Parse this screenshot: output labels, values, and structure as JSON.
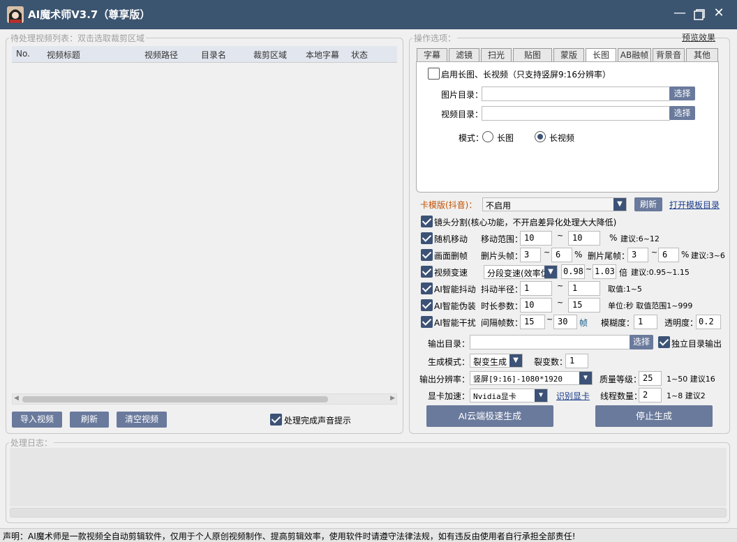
{
  "window": {
    "title": "AI魔术师V3.7（尊享版）",
    "min_icon": "minimize-icon",
    "max_icon": "maximize-icon",
    "close_icon": "close-icon"
  },
  "video_list": {
    "legend": "待处理视频列表：双击选取裁剪区域",
    "columns": [
      "No.",
      "视频标题",
      "视频路径",
      "目录名",
      "裁剪区域",
      "本地字幕",
      "状态"
    ],
    "import_btn": "导入视频",
    "refresh_btn": "刷新",
    "clear_btn": "清空视频",
    "sound_tip": "处理完成声音提示"
  },
  "options": {
    "legend": "操作选项：",
    "preview_link": "预览效果",
    "tabs": [
      "字幕",
      "滤镜",
      "扫光",
      "贴图",
      "蒙版",
      "长图",
      "AB融帧",
      "背景音",
      "其他"
    ],
    "active_tab": "长图",
    "longimg": {
      "enable": "启用长图、长视频（只支持竖屏9:16分辨率）",
      "img_dir": "图片目录：",
      "video_dir": "视频目录：",
      "choose": "选择",
      "mode": "模式：",
      "mode_a": "长图",
      "mode_b": "长视频",
      "mode_selected": "长视频"
    }
  },
  "template": {
    "label": "卡模版(抖音)：",
    "value": "不启用",
    "refresh": "刷新",
    "open_dir": "打开模板目录"
  },
  "features": {
    "lens_split": "镜头分割(核心功能，不开启差异化处理大大降低)",
    "random_move": {
      "label": "随机移动",
      "range_label": "移动范围：",
      "from": "10",
      "to": "10",
      "unit": "%",
      "hint": "建议:6~12"
    },
    "frame_cut": {
      "label": "画面删帧",
      "head_label": "删片头帧：",
      "head_from": "3",
      "head_to": "6",
      "tail_label": "删片尾帧：",
      "tail_from": "3",
      "tail_to": "6",
      "unit": "%",
      "hint": "建议:3~6"
    },
    "speed": {
      "label": "视频变速",
      "mode": "分段变速(效率优",
      "from": "0.98",
      "to": "1.03",
      "unit": "倍",
      "hint": "建议:0.95~1.15"
    },
    "shake": {
      "label": "AI智能抖动",
      "radius_label": "抖动半径：",
      "from": "1",
      "to": "1",
      "hint": "取值:1~5"
    },
    "disguise": {
      "label": "AI智能伪装",
      "duration_label": "时长参数：",
      "from": "10",
      "to": "15",
      "hint": "单位:秒 取值范围1~999"
    },
    "interfere": {
      "label": "AI智能干扰",
      "interval_label": "间隔帧数：",
      "from": "15",
      "to": "30",
      "unit": "帧",
      "blur_label": "模糊度：",
      "blur": "1",
      "alpha_label": "透明度：",
      "alpha": "0.2"
    }
  },
  "output": {
    "dir_label": "输出目录：",
    "dir": "",
    "choose": "选择",
    "independent": "独立目录输出",
    "gen_mode_label": "生成模式：",
    "gen_mode": "裂变生成",
    "count_label": "裂变数：",
    "count": "1",
    "resolution_label": "输出分辨率：",
    "resolution": "竖屏[9:16]-1080*1920",
    "quality_label": "质量等级：",
    "quality": "25",
    "quality_hint": "1~50 建议16",
    "gpu_label": "显卡加速：",
    "gpu": "Nvidia显卡",
    "detect_gpu": "识别显卡",
    "threads_label": "线程数量：",
    "threads": "2",
    "threads_hint": "1~8 建议2",
    "cloud_btn": "AI云端极速生成",
    "stop_btn": "停止生成"
  },
  "log": {
    "legend": "处理日志："
  },
  "status": "声明：AI魔术师是一款视频全自动剪辑软件，仅用于个人原创视频制作、提高剪辑效率，使用软件时请遵守法律法规，如有违反由使用者自行承担全部责任!"
}
